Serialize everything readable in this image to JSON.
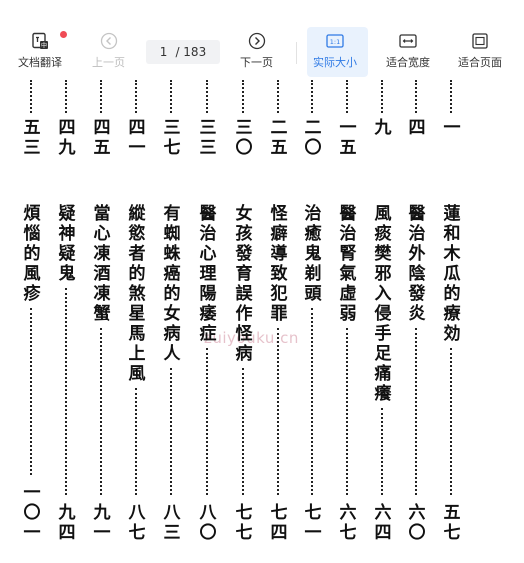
{
  "toolbar": {
    "translate_label": "文档翻译",
    "prev_label": "上一页",
    "page_current": "1",
    "page_total": "/ 183",
    "next_label": "下一页",
    "actual_size_label": "实际大小",
    "fit_width_label": "适合宽度",
    "fit_page_label": "适合页面",
    "actual_size_icon_text": "1:1"
  },
  "colors": {
    "accent": "#2f7ae5",
    "badge": "#f04b55",
    "active_bg": "#e9f2fd"
  },
  "icons": {
    "translate": "document-translate-icon",
    "prev": "circle-chevron-left-icon",
    "next": "circle-chevron-right-icon",
    "actual_size": "one-to-one-icon",
    "fit_width": "fit-width-icon",
    "fit_page": "fit-page-icon"
  },
  "toc": [
    {
      "title": "蓮和木瓜的療効",
      "page_top": "一",
      "page_bottom": "五七"
    },
    {
      "title": "醫治外陰發炎",
      "page_top": "四",
      "page_bottom": "六〇"
    },
    {
      "title": "風痰樊邪入侵手足痛癢",
      "page_top": "九",
      "page_bottom": "六四"
    },
    {
      "title": "醫治腎氣虛弱",
      "page_top": "一五",
      "page_bottom": "六七"
    },
    {
      "title": "治癒鬼剃頭",
      "page_top": "二〇",
      "page_bottom": "七一"
    },
    {
      "title": "怪癖導致犯罪",
      "page_top": "二五",
      "page_bottom": "七四"
    },
    {
      "title": "女孩發育誤作怪病",
      "page_top": "三〇",
      "page_bottom": "七七"
    },
    {
      "title": "醫治心理陽痿症",
      "page_top": "三三",
      "page_bottom": "八〇"
    },
    {
      "title": "有蜘蛛癌的女病人",
      "page_top": "三七",
      "page_bottom": "八三"
    },
    {
      "title": "縱慾者的煞星馬上風",
      "page_top": "四一",
      "page_bottom": "八七"
    },
    {
      "title": "當心凍酒凍蟹",
      "page_top": "四五",
      "page_bottom": "九一"
    },
    {
      "title": "疑神疑鬼",
      "page_top": "四九",
      "page_bottom": "九四"
    },
    {
      "title": "煩惱的風疹",
      "page_top": "五三",
      "page_bottom": "一〇一"
    }
  ],
  "watermark": "zuiyouku.cn"
}
